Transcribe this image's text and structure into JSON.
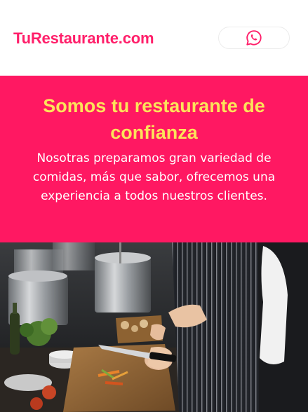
{
  "header": {
    "brand": "TuRestaurante.com",
    "whatsapp_icon": "whatsapp-icon"
  },
  "hero": {
    "title": "Somos tu restaurante de confianza",
    "description": "Nosotras preparamos gran variedad de comidas, más que sabor, ofrecemos una experiencia a todos nuestros clientes."
  },
  "colors": {
    "brand_pink": "#ff1862",
    "title_yellow": "#fce35a",
    "whatsapp_pink": "#ff1f6a"
  }
}
